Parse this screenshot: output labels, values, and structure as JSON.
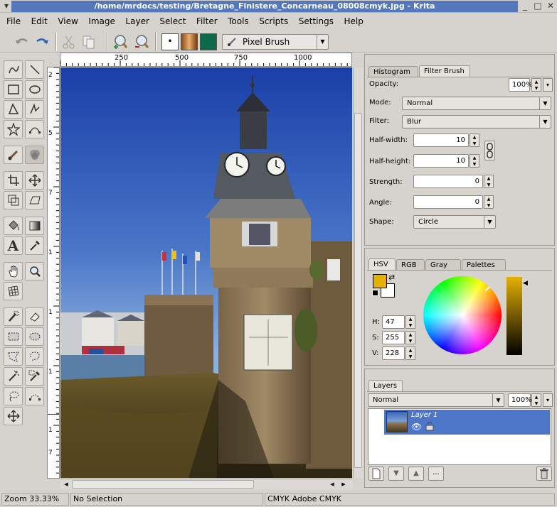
{
  "window": {
    "title": "/home/mrdocs/testing/Bretagne_Finistere_Concarneau_08008cmyk.jpg - Krita"
  },
  "menu": [
    "File",
    "Edit",
    "View",
    "Image",
    "Layer",
    "Select",
    "Filter",
    "Tools",
    "Scripts",
    "Settings",
    "Help"
  ],
  "toolbar": {
    "brush_label": "Pixel Brush",
    "brush_dot": "•"
  },
  "ruler": {
    "h_ticks": [
      "250",
      "500",
      "750",
      "1000"
    ],
    "v_ticks": [
      "2",
      "5",
      "7",
      "1",
      "1",
      "1",
      "1",
      "7"
    ]
  },
  "filter_brush": {
    "tabs": [
      "Histogram",
      "Filter Brush"
    ],
    "opacity_label": "Opacity:",
    "opacity_value": "100%",
    "mode_label": "Mode:",
    "mode_value": "Normal",
    "filter_label": "Filter:",
    "filter_value": "Blur",
    "halfwidth_label": "Half-width:",
    "halfwidth_value": "10",
    "halfheight_label": "Half-height:",
    "halfheight_value": "10",
    "strength_label": "Strength:",
    "strength_value": "0",
    "angle_label": "Angle:",
    "angle_value": "0",
    "shape_label": "Shape:",
    "shape_value": "Circle"
  },
  "color": {
    "tabs": [
      "HSV",
      "RGB",
      "Gray",
      "Palettes"
    ],
    "h_label": "H:",
    "h_value": "47",
    "s_label": "S:",
    "s_value": "255",
    "v_label": "V:",
    "v_value": "228",
    "fg_color": "#e4b100",
    "bg_color": "#ffffff"
  },
  "layers": {
    "tab": "Layers",
    "mode_value": "Normal",
    "opacity_value": "100%",
    "layer_name": "Layer 1",
    "add_label": "...",
    "selection_color": "#4d76c8"
  },
  "status": {
    "zoom": "Zoom 33.33%",
    "selection": "No Selection",
    "profile": "CMYK  Adobe CMYK"
  }
}
